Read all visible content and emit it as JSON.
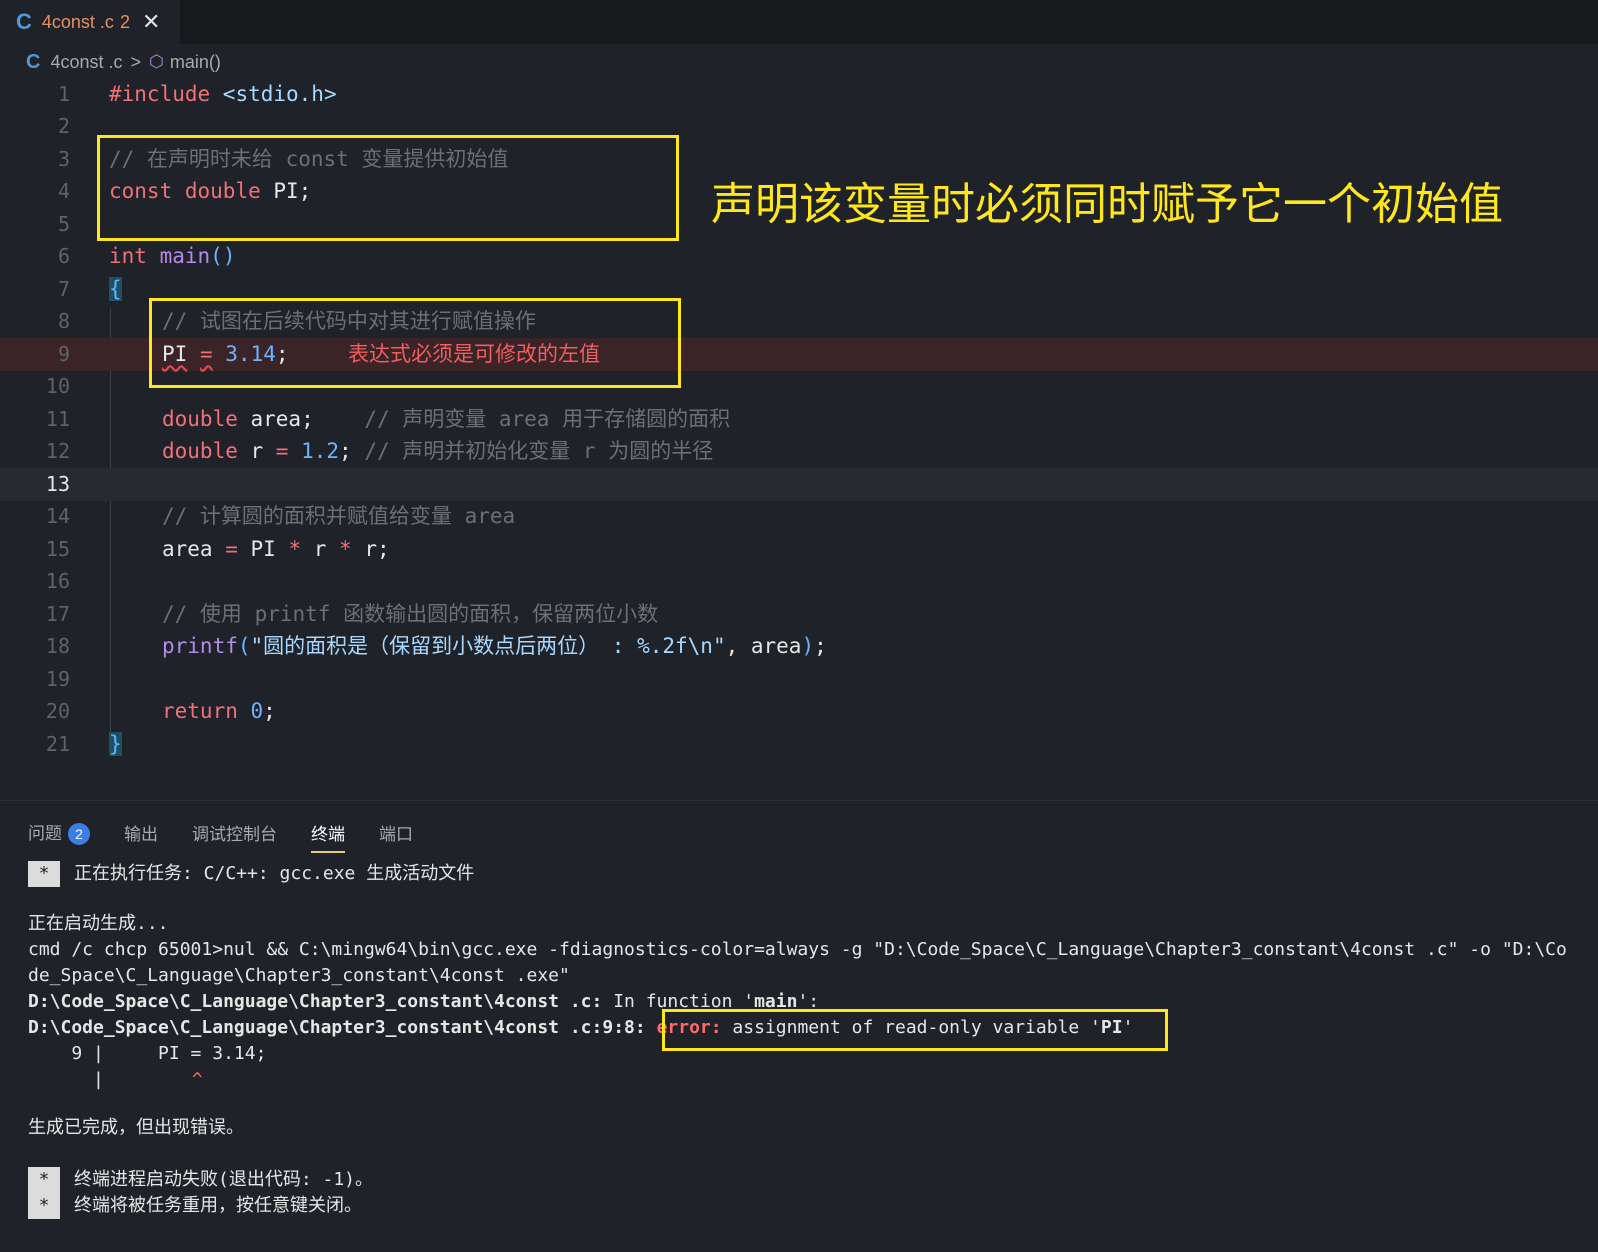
{
  "tab": {
    "icon": "C",
    "filename": "4const .c",
    "problem_count": "2",
    "close_symbol": "✕"
  },
  "breadcrumb": {
    "file": "4const .c",
    "separator": ">",
    "symbol": "main()"
  },
  "editor": {
    "lines": [
      {
        "n": "1"
      },
      {
        "n": "2"
      },
      {
        "n": "3"
      },
      {
        "n": "4"
      },
      {
        "n": "5"
      },
      {
        "n": "6"
      },
      {
        "n": "7"
      },
      {
        "n": "8"
      },
      {
        "n": "9"
      },
      {
        "n": "10"
      },
      {
        "n": "11"
      },
      {
        "n": "12"
      },
      {
        "n": "13"
      },
      {
        "n": "14"
      },
      {
        "n": "15"
      },
      {
        "n": "16"
      },
      {
        "n": "17"
      },
      {
        "n": "18"
      },
      {
        "n": "19"
      },
      {
        "n": "20"
      },
      {
        "n": "21"
      }
    ],
    "l1_kw": "#include",
    "l1_hdr": " <stdio.h>",
    "l3_cmt": "// 在声明时未给 const 变量提供初始值",
    "l4_const": "const",
    "l4_double": "double",
    "l4_rest": " PI;",
    "l6_int": "int",
    "l6_main": "main",
    "l6_paren": "()",
    "l7_brace": "{",
    "l8_cmt": "// 试图在后续代码中对其进行赋值操作",
    "l9_pi": "PI",
    "l9_eq": "=",
    "l9_num": "3.14",
    "l9_semi": ";",
    "l9_error": "表达式必须是可修改的左值",
    "l11_type": "double",
    "l11_rest": " area;    ",
    "l11_cmt": "// 声明变量 area 用于存储圆的面积",
    "l12_type": "double",
    "l12_r": " r ",
    "l12_eq": "=",
    "l12_num": "1.2",
    "l12_semi": "; ",
    "l12_cmt": "// 声明并初始化变量 r 为圆的半径",
    "l14_cmt": "// 计算圆的面积并赋值给变量 area",
    "l15_area": "area ",
    "l15_eq": "=",
    "l15_pi": " PI ",
    "l15_mul1": "*",
    "l15_r1": " r ",
    "l15_mul2": "*",
    "l15_r2": " r;",
    "l17_cmt": "// 使用 printf 函数输出圆的面积，保留两位小数",
    "l18_fn": "printf",
    "l18_open": "(",
    "l18_str": "\"圆的面积是（保留到小数点后两位） : %.2f\\n\"",
    "l18_rest": ", area",
    "l18_close": ")",
    "l18_semi": ";",
    "l20_ret": "return",
    "l20_num": "0",
    "l20_semi": ";",
    "l21_brace": "}"
  },
  "annotation": "声明该变量时必须同时赋予它一个初始值",
  "panel": {
    "tabs": [
      "问题",
      "输出",
      "调试控制台",
      "终端",
      "端口"
    ],
    "problems_badge": "2",
    "active_tab": "终端"
  },
  "terminal": {
    "star": "*",
    "task": "正在执行任务: C/C++: gcc.exe 生成活动文件",
    "starting": "正在启动生成...",
    "cmd1": "cmd /c chcp 65001>nul && C:\\mingw64\\bin\\gcc.exe -fdiagnostics-color=always -g \"D:\\Code_Space\\C_Language\\Chapter3_constant\\4const .c\" -o \"D:\\Co",
    "cmd2": "de_Space\\C_Language\\Chapter3_constant\\4const .exe\"",
    "infn_path": "D:\\Code_Space\\C_Language\\Chapter3_constant\\4const .c:",
    "infn_text": " In function '",
    "infn_main": "main",
    "infn_end": "':",
    "err_path": "D:\\Code_Space\\C_Language\\Chapter3_constant\\4const .c:9:8:",
    "err_word": "error:",
    "err_msg": " assignment of read-only variable '",
    "err_pi": "PI",
    "err_end": "'",
    "src_line": "    9 |     PI = 3.14;",
    "caret_pipe": "      |",
    "caret": "^",
    "done": "生成已完成，但出现错误。",
    "fail1": "终端进程启动失败(退出代码: -1)。",
    "fail2": "终端将被任务重用，按任意键关闭。"
  }
}
